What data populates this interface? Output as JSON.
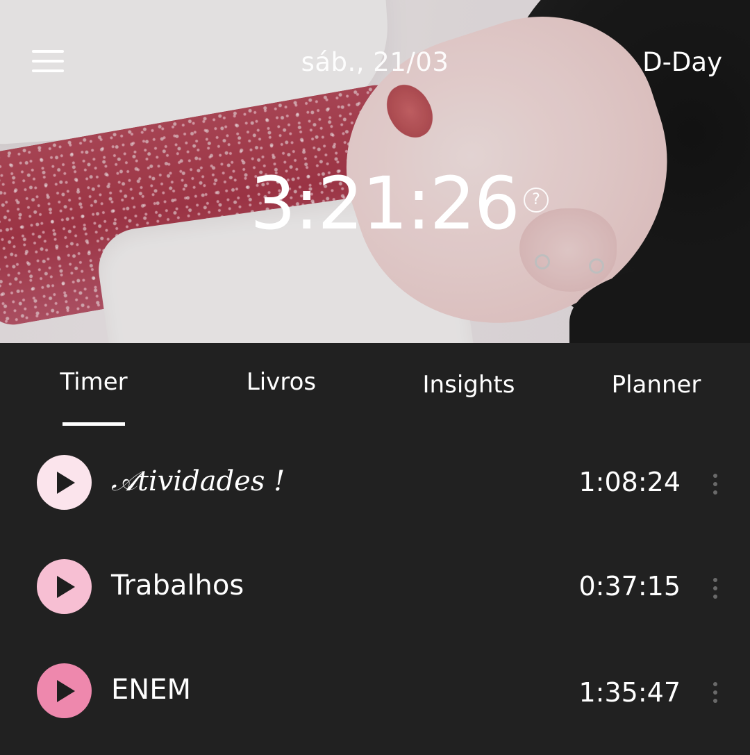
{
  "header": {
    "date": "sáb., 21/03",
    "dday_label": "D-Day",
    "total_timer": "3:21:26",
    "help_glyph": "?"
  },
  "tabs": [
    {
      "label": "Timer",
      "active": true
    },
    {
      "label": "Livros",
      "active": false
    },
    {
      "label": "Insights",
      "active": false
    },
    {
      "label": "Planner",
      "active": false
    }
  ],
  "subjects": [
    {
      "name": "𝒜tividades !",
      "time": "1:08:24",
      "color": "#fbe4ec"
    },
    {
      "name": "Trabalhos",
      "time": "0:37:15",
      "color": "#f7bfd3"
    },
    {
      "name": "ENEM",
      "time": "1:35:47",
      "color": "#ee88ad"
    }
  ],
  "colors": {
    "background": "#212121",
    "text": "#ffffff",
    "more_dots": "#6a6a6a"
  }
}
